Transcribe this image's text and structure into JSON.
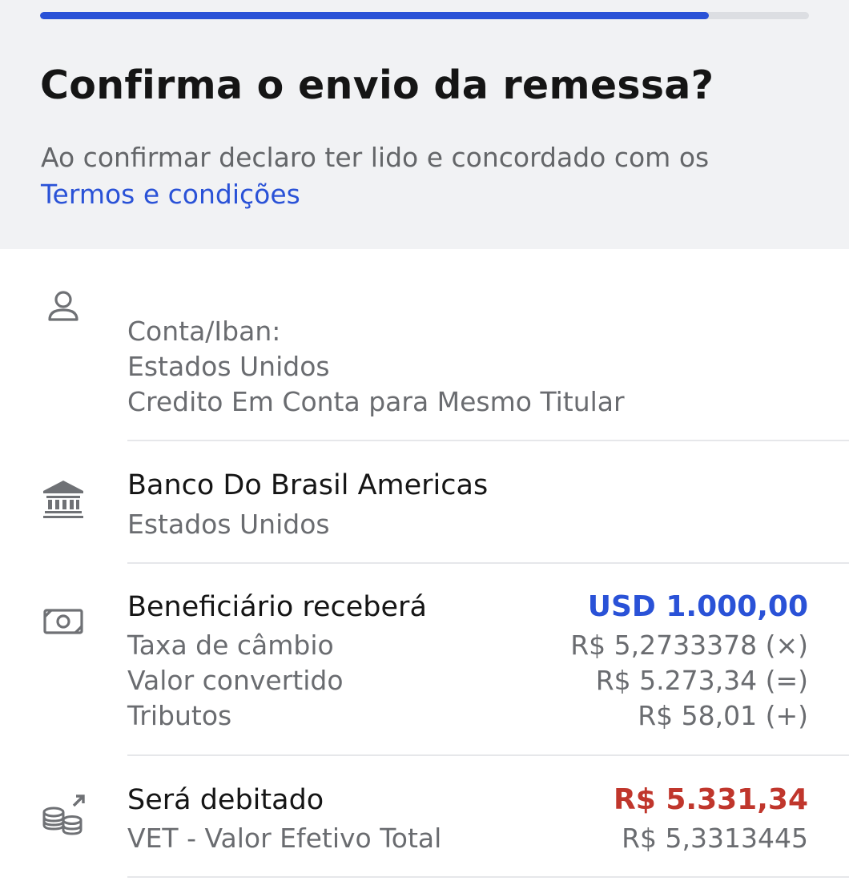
{
  "progress": {
    "value_percent": 87
  },
  "header": {
    "title": "Confirma o envio da remessa?",
    "subtitle_text": "Ao confirmar declaro ter lido e concordado com os",
    "terms_link": "Termos e condições"
  },
  "recipient": {
    "icon": "person-icon",
    "account_label": "Conta/Iban:",
    "country": "Estados Unidos",
    "type": "Credito Em Conta para Mesmo Titular"
  },
  "bank": {
    "icon": "bank-icon",
    "name": "Banco Do Brasil Americas",
    "country": "Estados Unidos"
  },
  "exchange": {
    "icon": "money-icon",
    "title": "Beneficiário receberá",
    "amount": "USD 1.000,00",
    "rows": [
      {
        "label": "Taxa de câmbio",
        "value": "R$ 5,2733378 (×)"
      },
      {
        "label": "Valor convertido",
        "value": "R$ 5.273,34 (=)"
      },
      {
        "label": "Tributos",
        "value": "R$ 58,01 (+)"
      }
    ]
  },
  "debit": {
    "icon": "coins-debit-icon",
    "title": "Será debitado",
    "amount": "R$ 5.331,34",
    "vet_label": "VET - Valor Efetivo Total",
    "vet_value": "R$ 5,3313445"
  },
  "colors": {
    "accent_blue": "#2a52d7",
    "debit_red": "#c0362c",
    "header_bg": "#f1f2f4",
    "muted_text": "#6a6c70"
  }
}
